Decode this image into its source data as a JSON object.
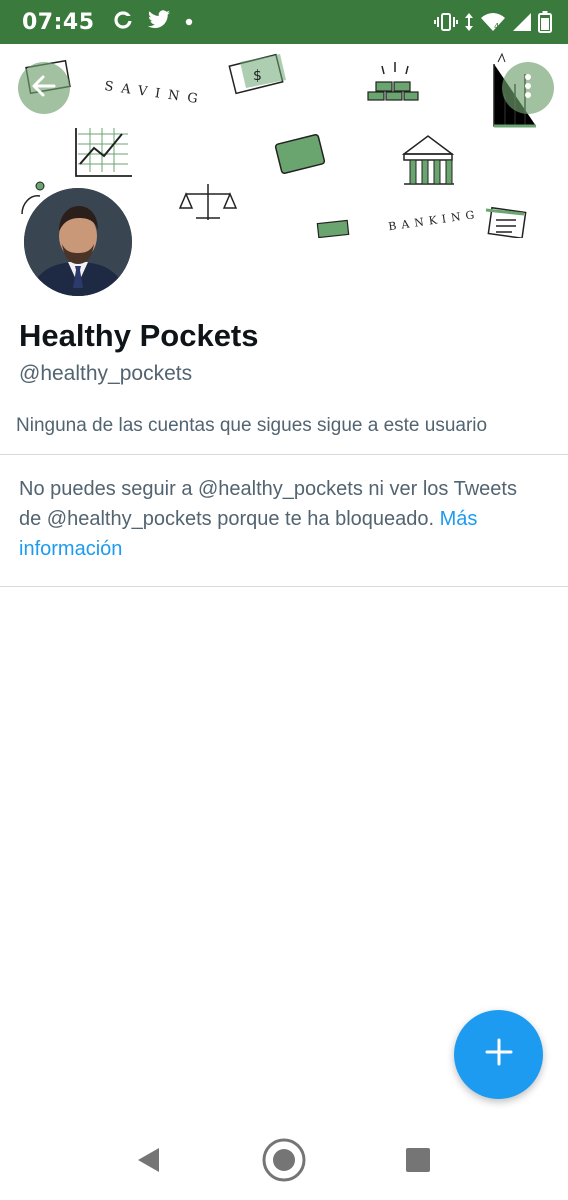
{
  "status_bar": {
    "time": "07:45",
    "left_icons": [
      "sync-icon",
      "twitter-bird-icon",
      "notification-dot-icon"
    ],
    "right_icons": [
      "vibrate-icon",
      "data-arrows-icon",
      "wifi-icon",
      "signal-icon",
      "battery-icon"
    ],
    "color": "#3b7a3d"
  },
  "banner": {
    "word_saving": "SAVING",
    "word_banking": "BANKING"
  },
  "header": {
    "back_icon": "arrow-left-icon",
    "more_icon": "more-vertical-icon"
  },
  "profile": {
    "display_name": "Healthy Pockets",
    "handle": "@healthy_pockets",
    "followers_note": "Ninguna de las cuentas que sigues sigue a este usuario"
  },
  "blocked": {
    "message": "No puedes seguir a @healthy_pockets ni ver los Tweets de @healthy_pockets porque te ha bloqueado.",
    "link_label": "Más información"
  },
  "fab": {
    "icon": "plus-icon",
    "color": "#1d9bf0"
  },
  "nav": {
    "back_icon": "nav-back-triangle-icon",
    "home_icon": "nav-home-circle-icon",
    "recents_icon": "nav-recents-square-icon"
  }
}
